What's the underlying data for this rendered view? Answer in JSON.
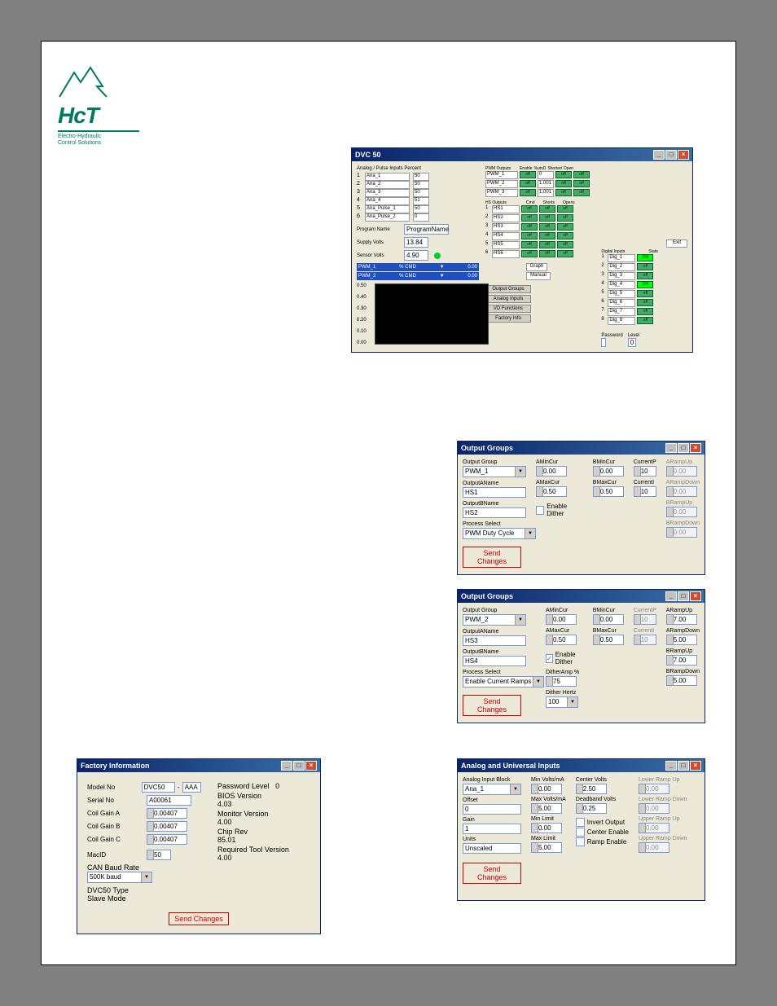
{
  "logo": {
    "brand": "HcT",
    "sub1": "Electro-Hydraulic",
    "sub2": "Control Solutions"
  },
  "dvc50": {
    "title": "DVC 50",
    "analog_header": "Analog / Pulse Inputs    Percent",
    "ana_rows": [
      {
        "n": "1",
        "name": "Ana_1",
        "pct": "50"
      },
      {
        "n": "2",
        "name": "Ana_2",
        "pct": "50"
      },
      {
        "n": "3",
        "name": "Ana_3",
        "pct": "50"
      },
      {
        "n": "4",
        "name": "Ana_4",
        "pct": "51"
      },
      {
        "n": "5",
        "name": "Ana_Pulse_1",
        "pct": "50"
      },
      {
        "n": "6",
        "name": "Ana_Pulse_2",
        "pct": "0"
      }
    ],
    "program_name_lbl": "Program Name",
    "program_name_val": "ProgramName",
    "supply_lbl": "Supply Volts",
    "supply_val": "13.84",
    "sensor_lbl": "Sensor Volts",
    "sensor_val": "4.90",
    "pwm1_bar": {
      "name": "PWM_1",
      "cmd": "% CMD",
      "val": "0.00"
    },
    "pwm2_bar": {
      "name": "PWM_2",
      "cmd": "% CMD",
      "val": "0.00"
    },
    "graph_btn": "Graph",
    "manual_btn": "Manual",
    "y_ticks": [
      "0.50",
      "0.40",
      "0.30",
      "0.20",
      "0.10",
      "0.00"
    ],
    "pwm_hdr": "PWM Outputs",
    "pwm_cols": [
      "Enable",
      "%utsD",
      "Shorted",
      "Open"
    ],
    "pwm_rows": [
      {
        "name": "PWM_1",
        "v": "0"
      },
      {
        "name": "PWM_2",
        "v": "1.001"
      },
      {
        "name": "PWM_3",
        "v": "1.001"
      }
    ],
    "hs_hdr": "HS Outputs",
    "hs_cols": [
      "Cmd",
      "Shorts",
      "Opens"
    ],
    "hs_rows": [
      {
        "n": "1",
        "name": "HS1"
      },
      {
        "n": "2",
        "name": "HS2"
      },
      {
        "n": "3",
        "name": "HS3"
      },
      {
        "n": "4",
        "name": "HS4"
      },
      {
        "n": "5",
        "name": "HS5"
      },
      {
        "n": "6",
        "name": "HS6"
      }
    ],
    "dig_hdr": "Digital Inputs",
    "dig_state": "State",
    "dig_rows": [
      {
        "n": "1",
        "name": "Dig_1",
        "on": true
      },
      {
        "n": "2",
        "name": "Dig_2",
        "on": false
      },
      {
        "n": "3",
        "name": "Dig_3",
        "on": false
      },
      {
        "n": "4",
        "name": "Dig_4",
        "on": true
      },
      {
        "n": "5",
        "name": "Dig_5",
        "on": false
      },
      {
        "n": "6",
        "name": "Dig_6",
        "on": false
      },
      {
        "n": "7",
        "name": "Dig_7",
        "on": false
      },
      {
        "n": "8",
        "name": "Dig_8",
        "on": false
      }
    ],
    "side_btns": [
      "Output Groups",
      "Analog Inputs",
      "I/O Functions",
      "Factory Info"
    ],
    "exit_btn": "Exit",
    "password_lbl": "Password",
    "level_lbl": "Level",
    "level_val": "0"
  },
  "og1": {
    "title": "Output Groups",
    "out_grp_lbl": "Output Group",
    "out_grp_val": "PWM_1",
    "outA_lbl": "OutputAName",
    "outA_val": "HS1",
    "outB_lbl": "OutputBName",
    "outB_val": "HS2",
    "proc_lbl": "Process Select",
    "proc_val": "PWM Duty Cycle",
    "amincur": "AMinCur",
    "amincur_v": "0.00",
    "bmincur": "BMinCur",
    "bmincur_v": "0.00",
    "amaxcur": "AMaxCur",
    "amaxcur_v": "0.50",
    "bmaxcur": "BMaxCur",
    "bmaxcur_v": "0.50",
    "currentp": "CurrentP",
    "currentp_v": "10",
    "currenti": "CurrentI",
    "currenti_v": "10",
    "arampup": "ARampUp",
    "arampup_v": "0.00",
    "arampdn": "ARampDown",
    "arampdn_v": "0.00",
    "brampup": "BRampUp",
    "brampup_v": "0.00",
    "brampdn": "BRampDown",
    "brampdn_v": "0.00",
    "dither_lbl": "Enable Dither",
    "send": "Send Changes"
  },
  "og2": {
    "title": "Output Groups",
    "out_grp_lbl": "Output Group",
    "out_grp_val": "PWM_2",
    "outA_lbl": "OutputAName",
    "outA_val": "HS3",
    "outB_lbl": "OutputBName",
    "outB_val": "HS4",
    "proc_lbl": "Process Select",
    "proc_val": "Enable Current Ramps",
    "amincur": "AMinCur",
    "amincur_v": "0.00",
    "bmincur": "BMinCur",
    "bmincur_v": "0.00",
    "amaxcur": "AMaxCur",
    "amaxcur_v": "0.50",
    "bmaxcur": "BMaxCur",
    "bmaxcur_v": "0.50",
    "currentp": "CurrentP",
    "currentp_v": "10",
    "currenti": "CurrentI",
    "currenti_v": "10",
    "arampup": "ARampUp",
    "arampup_v": "7.00",
    "arampdn": "ARampDown",
    "arampdn_v": "5.00",
    "brampup": "BRampUp",
    "brampup_v": "7.00",
    "brampdn": "BRampDown",
    "brampdn_v": "5.00",
    "dither_lbl": "Enable Dither",
    "dither_chk": "✓",
    "dither_amp_lbl": "DitherAmp %",
    "dither_amp_v": "75",
    "dither_hz_lbl": "Dither Hertz",
    "dither_hz_v": "100",
    "send": "Send Changes"
  },
  "ana": {
    "title": "Analog and Universal Inputs",
    "block_lbl": "Analog Input Block",
    "block_val": "Ana_1",
    "offset_lbl": "Offset",
    "offset_val": "0",
    "gain_lbl": "Gain",
    "gain_val": "1",
    "units_lbl": "Units",
    "units_val": "Unscaled",
    "minv_lbl": "Min Volts/mA",
    "minv_v": "0.00",
    "maxv_lbl": "Max Volts/mA",
    "maxv_v": "5.00",
    "minl_lbl": "Min Limit",
    "minl_v": "0.00",
    "maxl_lbl": "Max Limit",
    "maxl_v": "5.00",
    "centerv_lbl": "Center Volts",
    "centerv_v": "2.50",
    "deadb_lbl": "Deadband Volts",
    "deadb_v": "0.25",
    "invert_lbl": "Invert Output",
    "center_en_lbl": "Center Enable",
    "ramp_en_lbl": "Ramp Enable",
    "lru_lbl": "Lower Ramp Up",
    "lru_v": "0.00",
    "lrd_lbl": "Lower Ramp Down",
    "lrd_v": "0.00",
    "uru_lbl": "Upper Ramp Up",
    "uru_v": "0.00",
    "urd_lbl": "Upper Ramp Down",
    "urd_v": "0.00",
    "send": "Send Changes"
  },
  "factory": {
    "title": "Factory Information",
    "model_lbl": "Model No",
    "model_v": "DVC50",
    "model_ext": "AAA",
    "serial_lbl": "Serial No",
    "serial_v": "A00061",
    "cga_lbl": "Coil Gain A",
    "cga_v": "0.00407",
    "cgb_lbl": "Coil Gain B",
    "cgb_v": "0.00407",
    "cgc_lbl": "Coil Gain C",
    "cgc_v": "0.00407",
    "macid_lbl": "MacID",
    "macid_v": "50",
    "baud_lbl": "CAN Baud Rate",
    "baud_v": "500K baud",
    "type_lbl": "DVC50 Type",
    "type_v": "Slave Mode",
    "pw_lbl": "Password Level",
    "pw_v": "0",
    "bios_lbl": "BIOS Version",
    "bios_v": "4.03",
    "mon_lbl": "Monitor Version",
    "mon_v": "4.00",
    "chip_lbl": "Chip Rev",
    "chip_v": "85.01",
    "tool_lbl": "Required Tool Version",
    "tool_v": "4.00",
    "send": "Send Changes"
  }
}
